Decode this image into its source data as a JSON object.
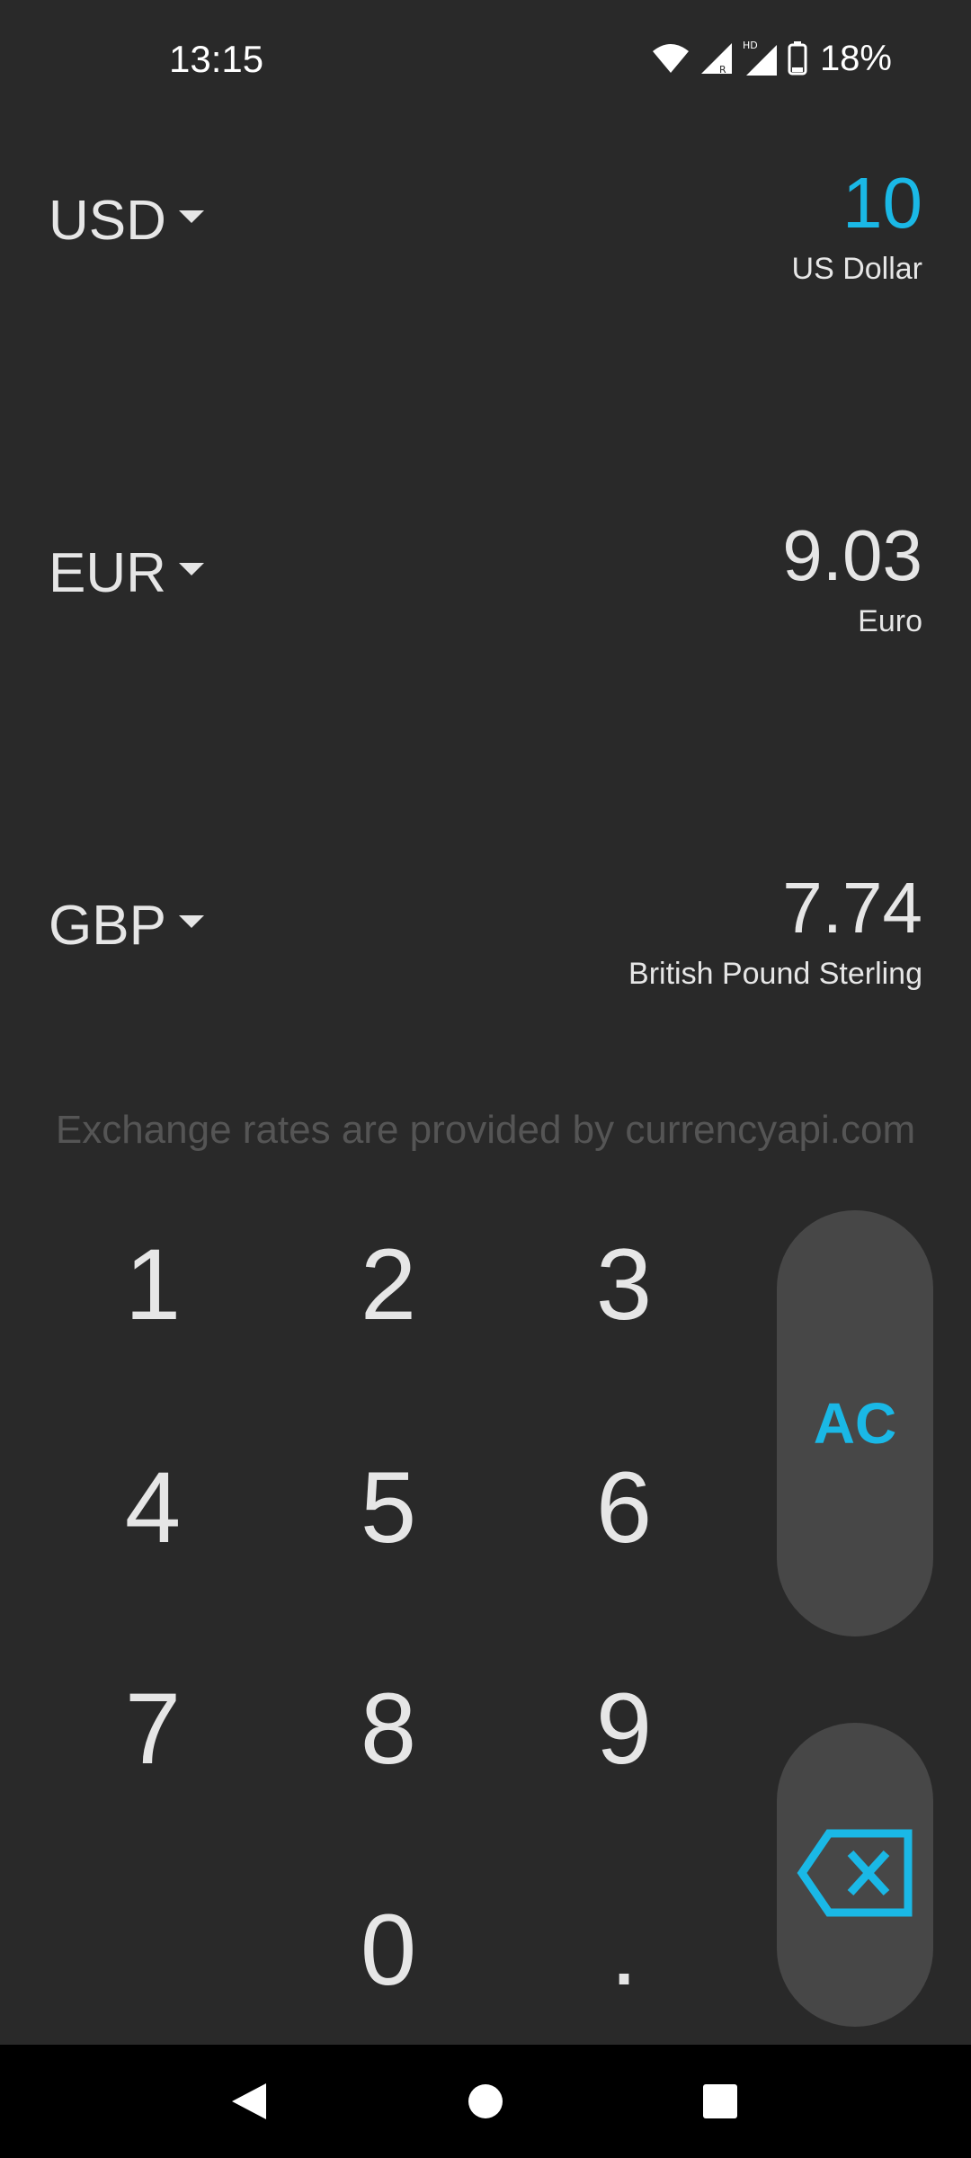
{
  "status_bar": {
    "time": "13:15",
    "battery": "18%",
    "icons": [
      "wifi-icon",
      "signal-r-icon",
      "signal-hd-icon",
      "battery-icon"
    ]
  },
  "currencies": [
    {
      "code": "USD",
      "value": "10",
      "name": "US Dollar",
      "active": true
    },
    {
      "code": "EUR",
      "value": "9.03",
      "name": "Euro",
      "active": false
    },
    {
      "code": "GBP",
      "value": "7.74",
      "name": "British Pound Sterling",
      "active": false
    }
  ],
  "credit": "Exchange rates are provided by currencyapi.com",
  "keypad": {
    "k1": "1",
    "k2": "2",
    "k3": "3",
    "k4": "4",
    "k5": "5",
    "k6": "6",
    "k7": "7",
    "k8": "8",
    "k9": "9",
    "k0": "0",
    "dot": ".",
    "clear": "AC",
    "backspace_icon": "backspace-icon"
  },
  "nav_bar": {
    "icons": [
      "back-icon",
      "home-icon",
      "recents-icon"
    ]
  },
  "colors": {
    "background": "#292929",
    "accent": "#1ab8e6",
    "pill": "#474747",
    "text": "#e6e6e6",
    "muted": "#555555"
  }
}
